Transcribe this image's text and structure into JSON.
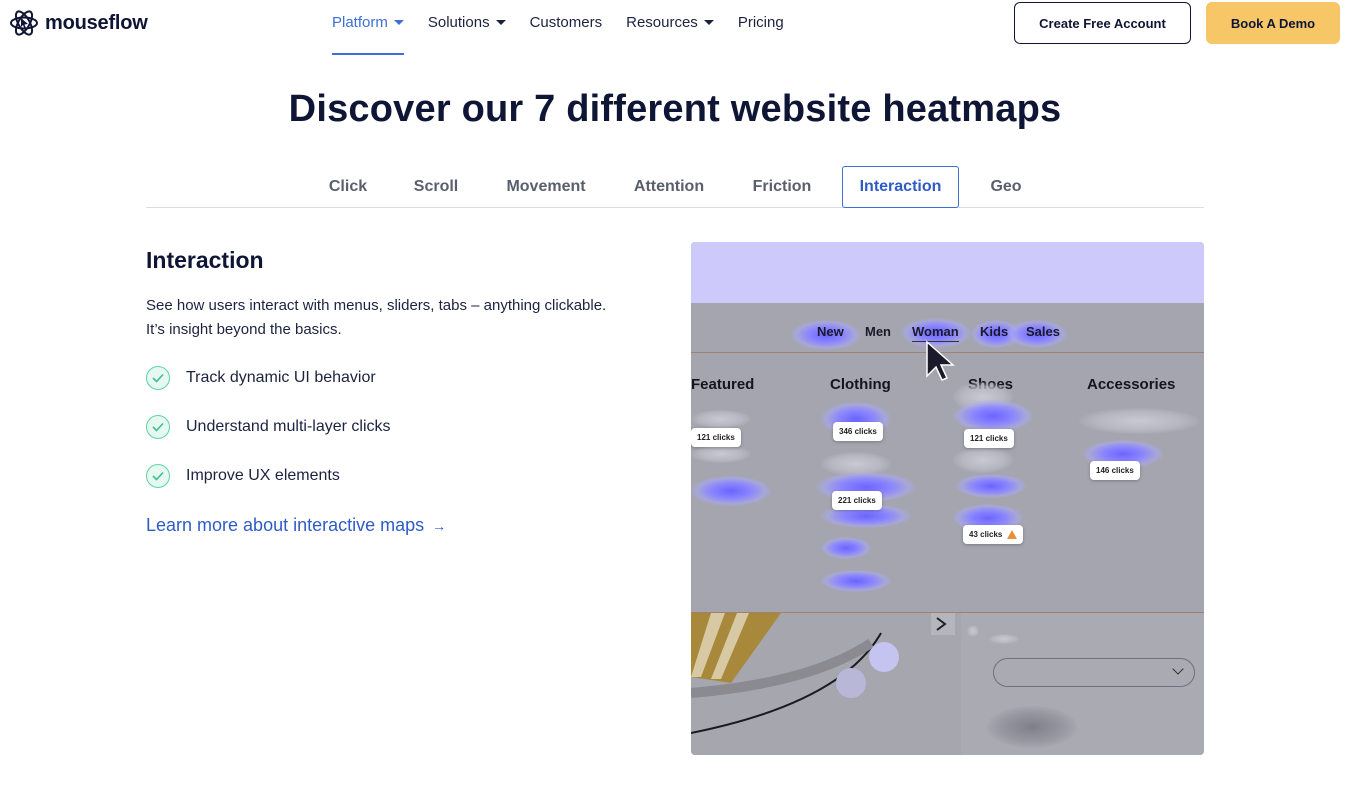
{
  "header": {
    "logo_text": "mouseflow",
    "nav": [
      {
        "label": "Platform",
        "has_caret": true,
        "active": true
      },
      {
        "label": "Solutions",
        "has_caret": true,
        "active": false
      },
      {
        "label": "Customers",
        "has_caret": false,
        "active": false
      },
      {
        "label": "Resources",
        "has_caret": true,
        "active": false
      },
      {
        "label": "Pricing",
        "has_caret": false,
        "active": false
      }
    ],
    "create_account_label": "Create Free Account",
    "book_demo_label": "Book A Demo"
  },
  "main": {
    "title": "Discover our 7 different website heatmaps",
    "tabs": [
      "Click",
      "Scroll",
      "Movement",
      "Attention",
      "Friction",
      "Interaction",
      "Geo"
    ],
    "active_tab": "Interaction",
    "section": {
      "title": "Interaction",
      "description_line1": "See how users interact with menus, sliders, tabs – anything clickable.",
      "description_line2": "It’s insight beyond the basics.",
      "features": [
        "Track dynamic UI behavior",
        "Understand multi-layer clicks",
        "Improve UX elements"
      ],
      "learn_more": "Learn more about interactive maps",
      "learn_more_arrow": "→"
    }
  },
  "heatmap": {
    "nav": [
      "New",
      "Men",
      "Woman",
      "Kids",
      "Sales"
    ],
    "columns": [
      "Featured",
      "Clothing",
      "Shoes",
      "Accessories"
    ],
    "labels": [
      "121 clicks",
      "346 clicks",
      "221 clicks",
      "121 clicks",
      "43 clicks",
      "146 clicks"
    ]
  },
  "colors": {
    "accent": "#3d6fd6",
    "demo_button": "#f6c667",
    "check": "#5dd3a6",
    "heat": "#6b64ff"
  }
}
